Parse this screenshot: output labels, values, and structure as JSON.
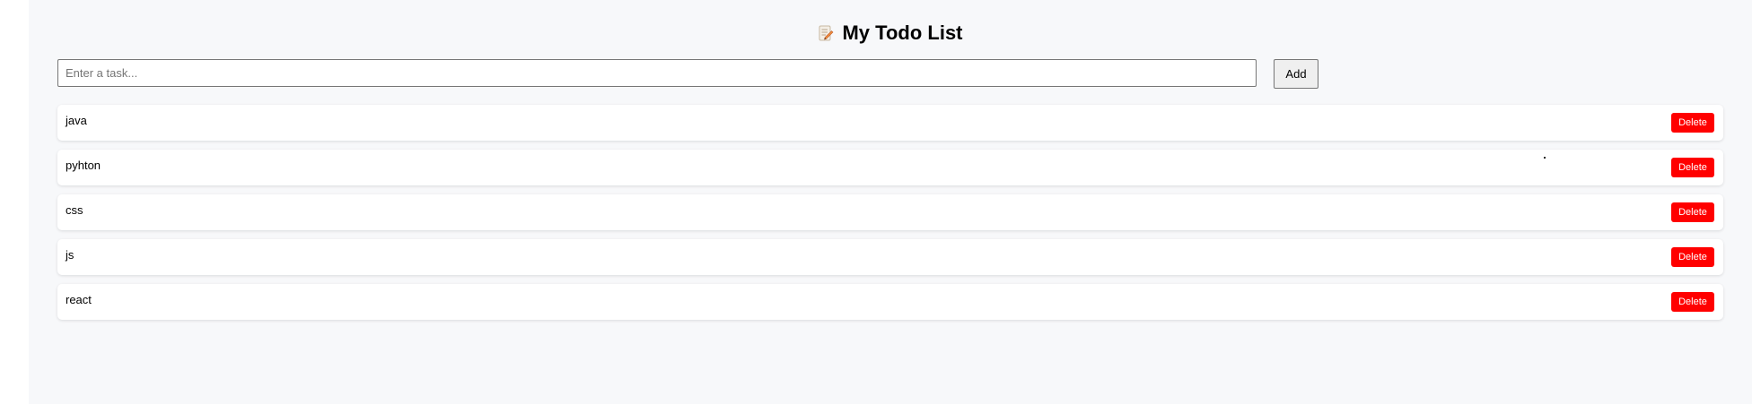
{
  "app": {
    "title": "My Todo List",
    "title_icon": "memo-icon"
  },
  "input": {
    "placeholder": "Enter a task...",
    "value": "",
    "add_label": "Add"
  },
  "todos": [
    {
      "text": "java",
      "delete_label": "Delete"
    },
    {
      "text": "pyhton",
      "delete_label": "Delete"
    },
    {
      "text": "css",
      "delete_label": "Delete"
    },
    {
      "text": "js",
      "delete_label": "Delete"
    },
    {
      "text": "react",
      "delete_label": "Delete"
    }
  ],
  "colors": {
    "page_background": "#f7f8fa",
    "delete_button": "#ff0000",
    "card_background": "#ffffff"
  }
}
